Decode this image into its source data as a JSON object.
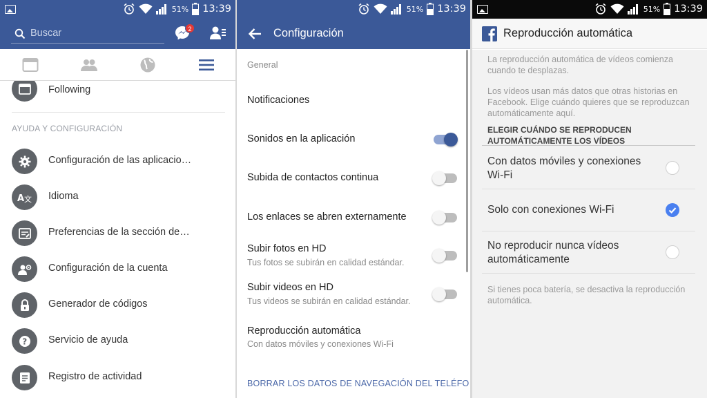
{
  "status_bar": {
    "battery_pct": "51%",
    "time": "13:39"
  },
  "panel1": {
    "search_placeholder": "Buscar",
    "messenger_badge": "2",
    "first_item": "Following",
    "section_header": "AYUDA Y CONFIGURACIÓN",
    "items": [
      {
        "label": "Configuración de las aplicacio…",
        "icon": "gear-icon"
      },
      {
        "label": "Idioma",
        "icon": "translate-icon"
      },
      {
        "label": "Preferencias de la sección de…",
        "icon": "news-feed-prefs-icon"
      },
      {
        "label": "Configuración de la cuenta",
        "icon": "account-settings-icon"
      },
      {
        "label": "Generador de códigos",
        "icon": "lock-icon"
      },
      {
        "label": "Servicio de ayuda",
        "icon": "help-icon"
      },
      {
        "label": "Registro de actividad",
        "icon": "activity-log-icon"
      }
    ]
  },
  "panel2": {
    "title": "Configuración",
    "section_general": "General",
    "settings": [
      {
        "title": "Notificaciones",
        "subtitle": "",
        "toggle": null
      },
      {
        "title": "Sonidos en la aplicación",
        "subtitle": "",
        "toggle": true
      },
      {
        "title": "Subida de contactos continua",
        "subtitle": "",
        "toggle": false
      },
      {
        "title": "Los enlaces se abren externamente",
        "subtitle": "",
        "toggle": false
      },
      {
        "title": "Subir fotos en HD",
        "subtitle": "Tus fotos se subirán en calidad estándar.",
        "toggle": false
      },
      {
        "title": "Subir videos en HD",
        "subtitle": "Tus videos se subirán en calidad estándar.",
        "toggle": false
      },
      {
        "title": "Reproducción automática",
        "subtitle": "Con datos móviles y conexiones Wi-Fi",
        "toggle": null
      }
    ],
    "clear_browsing": "BORRAR LOS DATOS DE NAVEGACIÓN DEL TELÉFO"
  },
  "panel3": {
    "title": "Reproducción automática",
    "desc1": "La reproducción automática de vídeos comienza cuando te desplazas.",
    "desc2": "Los vídeos usan más datos que otras historias en Facebook. Elige cuándo quieres que se reproduzcan automáticamente aquí.",
    "heading": "ELEGIR CUÁNDO SE REPRODUCEN AUTOMÁTICAMENTE LOS VÍDEOS",
    "options": [
      {
        "label": "Con datos móviles y conexiones Wi-Fi",
        "selected": false
      },
      {
        "label": "Solo con conexiones Wi-Fi",
        "selected": true
      },
      {
        "label": "No reproducir nunca vídeos automáticamente",
        "selected": false
      }
    ],
    "footer": "Si tienes poca batería, se desactiva la reproducción automática."
  },
  "colors": {
    "facebook_blue": "#3b5998",
    "toggle_on_track": "#8fa4d2",
    "radio_checked": "#4a80f0"
  }
}
